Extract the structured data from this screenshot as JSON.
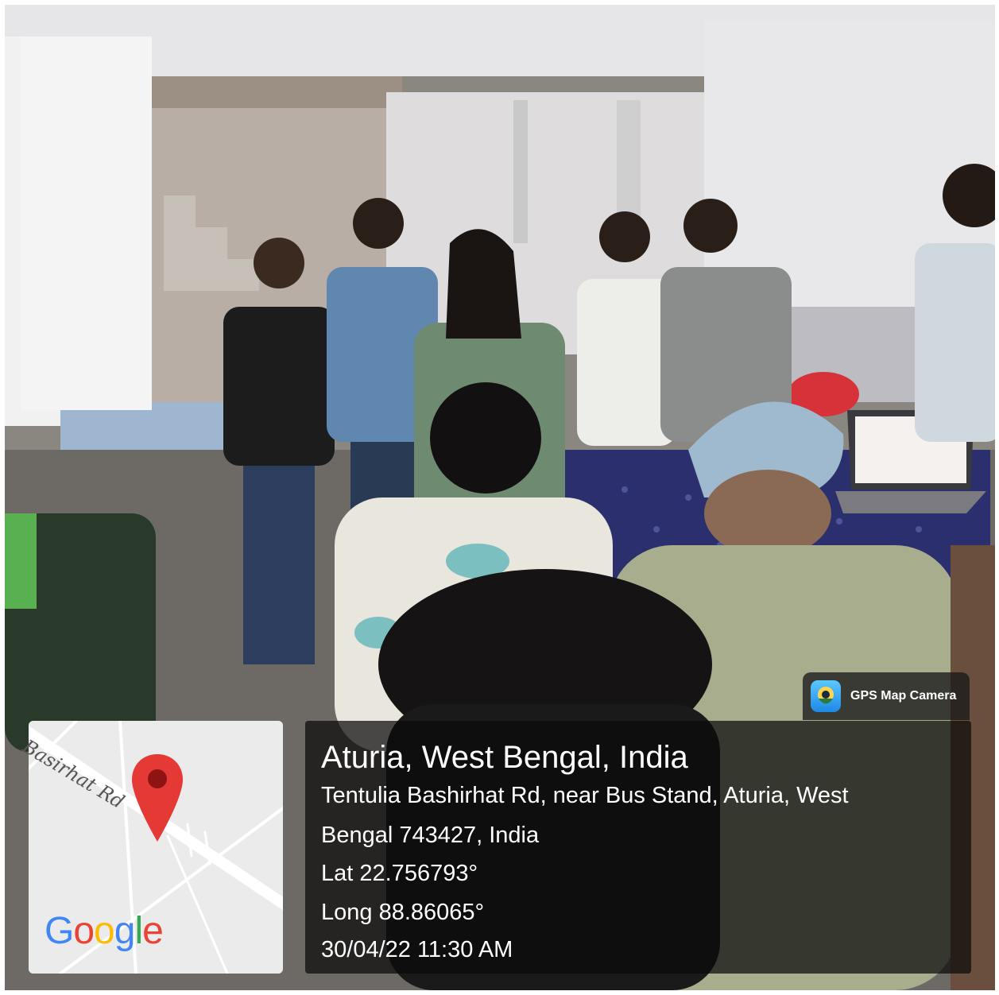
{
  "app_badge": {
    "label": "GPS Map Camera",
    "icon": "map-pin-camera-icon",
    "icon_color": "#1E88E5"
  },
  "map": {
    "road_label": "Basirhat Rd",
    "logo": "Google",
    "pin_icon": "map-pin-icon",
    "pin_color": "#E53935",
    "logo_colors": [
      "#4285F4",
      "#EA4335",
      "#FBBC05",
      "#4285F4",
      "#34A853",
      "#EA4335"
    ]
  },
  "location": {
    "title": "Aturia, West Bengal, India",
    "address_line1": "Tentulia Bashirhat Rd, near Bus Stand, Aturia, West",
    "address_line2": "Bengal 743427, India",
    "latitude": "Lat 22.756793°",
    "longitude": "Long 88.86065°",
    "datetime": "30/04/22 11:30 AM"
  }
}
